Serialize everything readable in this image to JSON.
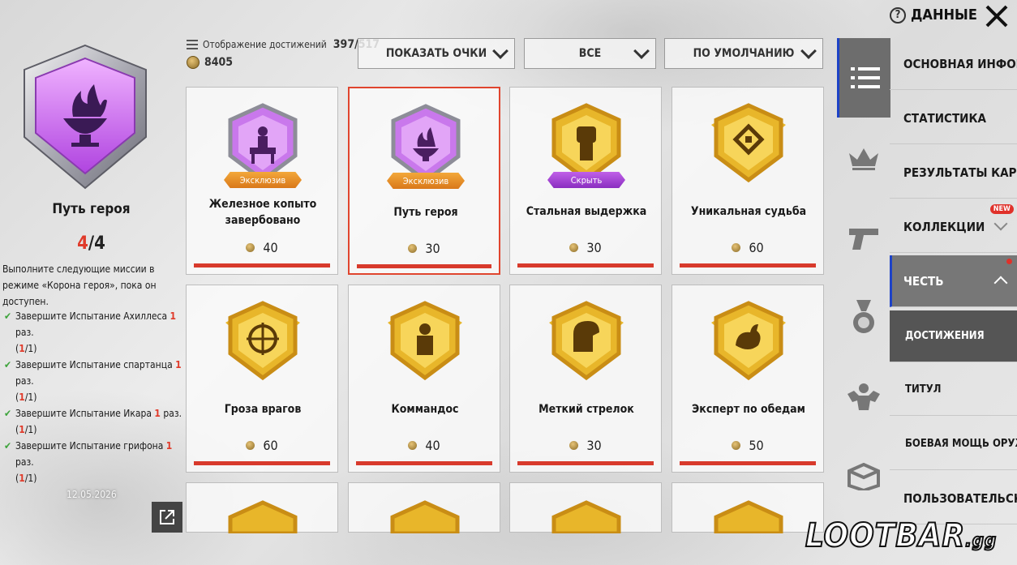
{
  "header": {
    "help_label": "ДАННЫЕ"
  },
  "summary": {
    "achievements_label": "Отображение достижений",
    "achievements_count": "397/517",
    "points": "8405"
  },
  "filters": {
    "show_points": "ПОКАЗАТЬ ОЧКИ",
    "category": "ВСЕ",
    "sort": "ПО УМОЛЧАНИЮ"
  },
  "detail": {
    "title": "Путь героя",
    "progress_current": "4",
    "progress_total": "/4",
    "description": "Выполните следующие миссии в режиме «Корона героя», пока он доступен.",
    "missions": [
      {
        "text": "Завершите Испытание Ахиллеса",
        "count": "1",
        "suffix": "раз.",
        "progress_cur": "1",
        "progress_total": "/1"
      },
      {
        "text": "Завершите Испытание спартанца",
        "count": "1",
        "suffix": "раз.",
        "progress_cur": "1",
        "progress_total": "/1"
      },
      {
        "text": "Завершите Испытание Икара",
        "count": "1",
        "suffix": "раз.",
        "progress_cur": "1",
        "progress_total": "/1"
      },
      {
        "text": "Завершите Испытание грифона",
        "count": "1",
        "suffix": "раз.",
        "progress_cur": "1",
        "progress_total": "/1"
      }
    ],
    "date": "12.05.2026"
  },
  "cards": [
    {
      "name": "Железное копыто завербовано",
      "tag": "Эксклюзив",
      "tag_color": "orange",
      "points": "40",
      "badge": "purple",
      "icon": "centaur-icon"
    },
    {
      "name": "Путь героя",
      "tag": "Эксклюзив",
      "tag_color": "orange",
      "points": "30",
      "badge": "purple",
      "icon": "flame-bowl-icon"
    },
    {
      "name": "Стальная выдержка",
      "tag": "Скрыть",
      "tag_color": "purple",
      "points": "30",
      "badge": "gold",
      "icon": "fist-icon"
    },
    {
      "name": "Уникальная судьба",
      "tag": "",
      "tag_color": "",
      "points": "60",
      "badge": "gold",
      "icon": "gem-icon"
    },
    {
      "name": "Гроза врагов",
      "tag": "",
      "tag_color": "",
      "points": "60",
      "badge": "gold",
      "icon": "crosshair-icon"
    },
    {
      "name": "Коммандос",
      "tag": "",
      "tag_color": "",
      "points": "40",
      "badge": "gold",
      "icon": "soldier-icon"
    },
    {
      "name": "Меткий стрелок",
      "tag": "",
      "tag_color": "",
      "points": "30",
      "badge": "gold",
      "icon": "helmet-icon"
    },
    {
      "name": "Эксперт по обедам",
      "tag": "",
      "tag_color": "",
      "points": "50",
      "badge": "gold",
      "icon": "chicken-icon"
    }
  ],
  "nav": {
    "items": [
      {
        "label": "ОСНОВНАЯ ИНФОРМАЦ"
      },
      {
        "label": "СТАТИСТИКА"
      },
      {
        "label": "РЕЗУЛЬТАТЫ КАРЬЕРЫ"
      },
      {
        "label": "КОЛЛЕКЦИИ",
        "badge": "NEW"
      },
      {
        "label": "ЧЕСТЬ"
      },
      {
        "label": "ДОСТИЖЕНИЯ"
      },
      {
        "label": "ТИТУЛ"
      },
      {
        "label": "БОЕВАЯ МОЩЬ ОРУЖИЯ"
      },
      {
        "label": "ПОЛЬЗОВАТЕЛЬСКОЕ"
      }
    ]
  },
  "watermark": {
    "main": "LOOTBAR",
    "suffix": ".gg"
  },
  "colors": {
    "accent_red": "#e0452e",
    "progress_red": "#d83a2c",
    "active_blue": "#1e43c7",
    "gold": "#e8b62a",
    "purple": "#b54fe0"
  }
}
